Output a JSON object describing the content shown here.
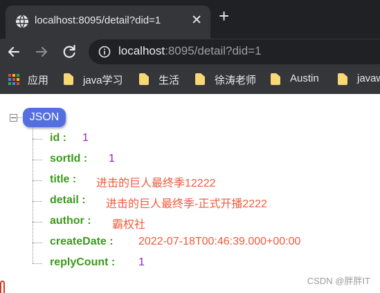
{
  "browser": {
    "tab": {
      "title": "localhost:8095/detail?did=1",
      "globe_icon": "globe-icon",
      "close_icon": "close-icon"
    },
    "new_tab_icon": "plus-icon",
    "nav": {
      "back_icon": "arrow-left-icon",
      "forward_icon": "arrow-right-icon",
      "reload_icon": "reload-icon"
    },
    "omnibox": {
      "info_icon": "info-icon",
      "url_host": "localhost",
      "url_rest": ":8095/detail?did=1"
    },
    "bookmarks": [
      {
        "label": "应用",
        "icon": "apps-grid-icon"
      },
      {
        "label": "java学习",
        "icon": "folder-icon"
      },
      {
        "label": "生活",
        "icon": "folder-icon"
      },
      {
        "label": "徐涛老师",
        "icon": "folder-icon"
      },
      {
        "label": "Austin",
        "icon": "folder-icon"
      },
      {
        "label": "javaw",
        "icon": "folder-icon"
      }
    ],
    "colors": {
      "tab_bar": "#202124",
      "toolbar": "#35363a",
      "text": "#e8eaed"
    }
  },
  "json_viewer": {
    "root_label": "JSON",
    "collapse_icon": "minus-box-icon",
    "fields": [
      {
        "key": "id :",
        "value": "1",
        "type": "number"
      },
      {
        "key": "sortId :",
        "value": "1",
        "type": "number"
      },
      {
        "key": "title :",
        "value": "进击的巨人最终季12222",
        "type": "string"
      },
      {
        "key": "detail :",
        "value": "进击的巨人最终季-正式开播2222",
        "type": "string"
      },
      {
        "key": "author :",
        "value": "霸权社",
        "type": "string"
      },
      {
        "key": "createDate :",
        "value": "2022-07-18T00:46:39.000+00:00",
        "type": "string"
      },
      {
        "key": "replyCount :",
        "value": "1",
        "type": "number"
      }
    ],
    "colors": {
      "key": "#3a9a1a",
      "number": "#9b19c9",
      "string": "#ef5a3c",
      "badge": "#5470e0"
    }
  },
  "watermark": "CSDN @胖胖IT"
}
